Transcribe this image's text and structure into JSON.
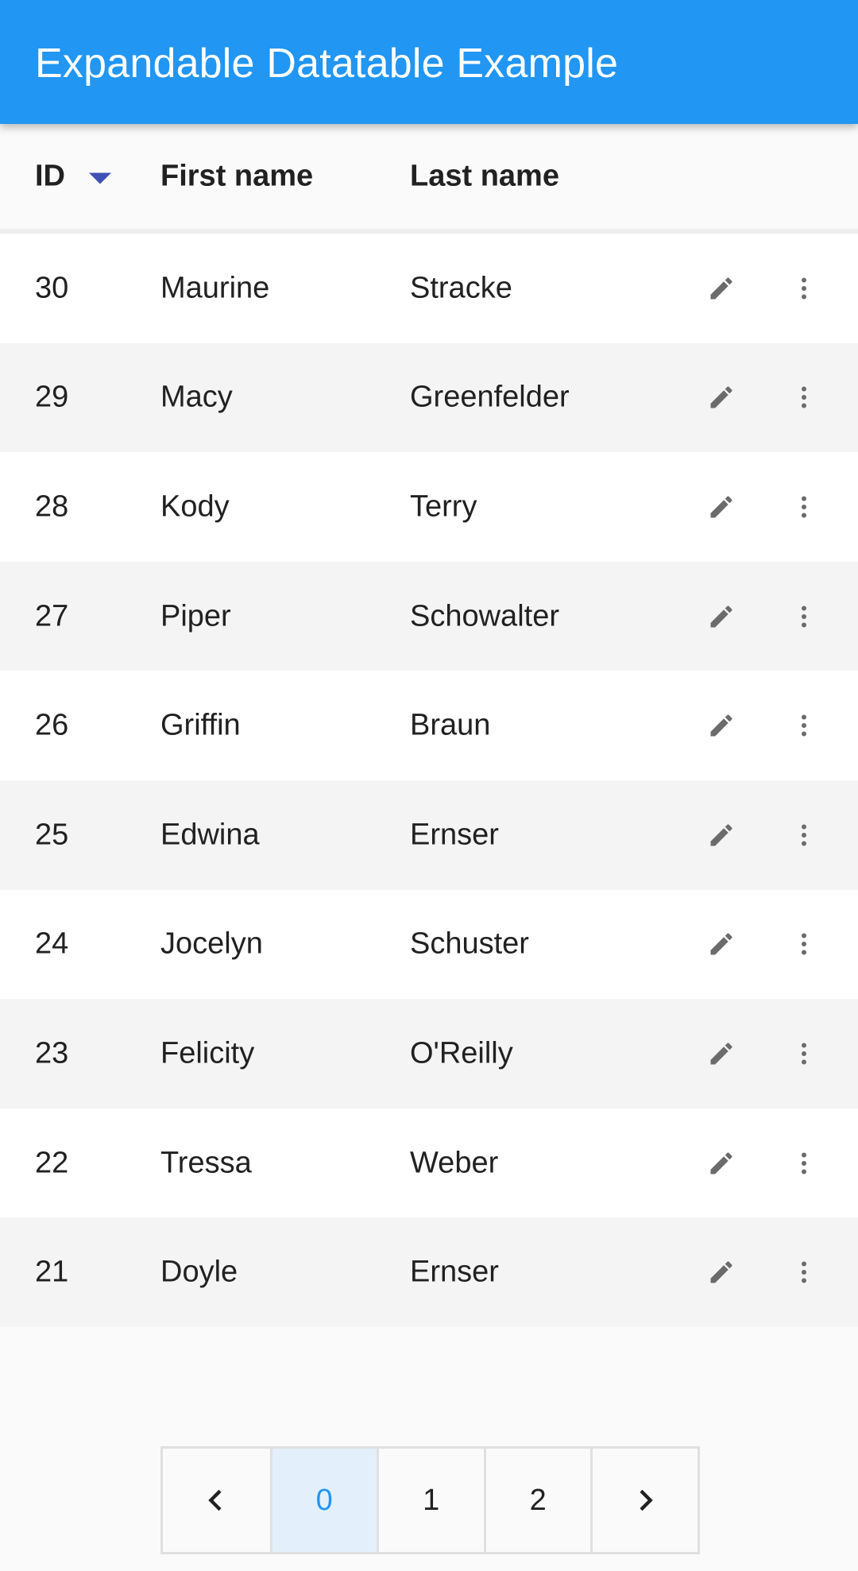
{
  "app_bar": {
    "title": "Expandable Datatable Example"
  },
  "table": {
    "columns": [
      {
        "label": "ID",
        "sorted": "descending"
      },
      {
        "label": "First name"
      },
      {
        "label": "Last name"
      }
    ],
    "rows": [
      {
        "id": "30",
        "first": "Maurine",
        "last": "Stracke"
      },
      {
        "id": "29",
        "first": "Macy",
        "last": "Greenfelder"
      },
      {
        "id": "28",
        "first": "Kody",
        "last": "Terry"
      },
      {
        "id": "27",
        "first": "Piper",
        "last": "Schowalter"
      },
      {
        "id": "26",
        "first": "Griffin",
        "last": "Braun"
      },
      {
        "id": "25",
        "first": "Edwina",
        "last": "Ernser"
      },
      {
        "id": "24",
        "first": "Jocelyn",
        "last": "Schuster"
      },
      {
        "id": "23",
        "first": "Felicity",
        "last": "O'Reilly"
      },
      {
        "id": "22",
        "first": "Tressa",
        "last": "Weber"
      },
      {
        "id": "21",
        "first": "Doyle",
        "last": "Ernser"
      }
    ],
    "row_actions": [
      "edit-icon",
      "more-vert-icon"
    ]
  },
  "pagination": {
    "prev_icon": "chevron-left-icon",
    "next_icon": "chevron-right-icon",
    "pages": [
      "0",
      "1",
      "2"
    ],
    "current_page": "0"
  },
  "colors": {
    "app_bar": "#2196f3",
    "sort_indicator": "#3f51b5",
    "active_page_text": "#2196f3",
    "active_page_bg": "#e3f0fb",
    "icon": "#6b6b6b"
  }
}
